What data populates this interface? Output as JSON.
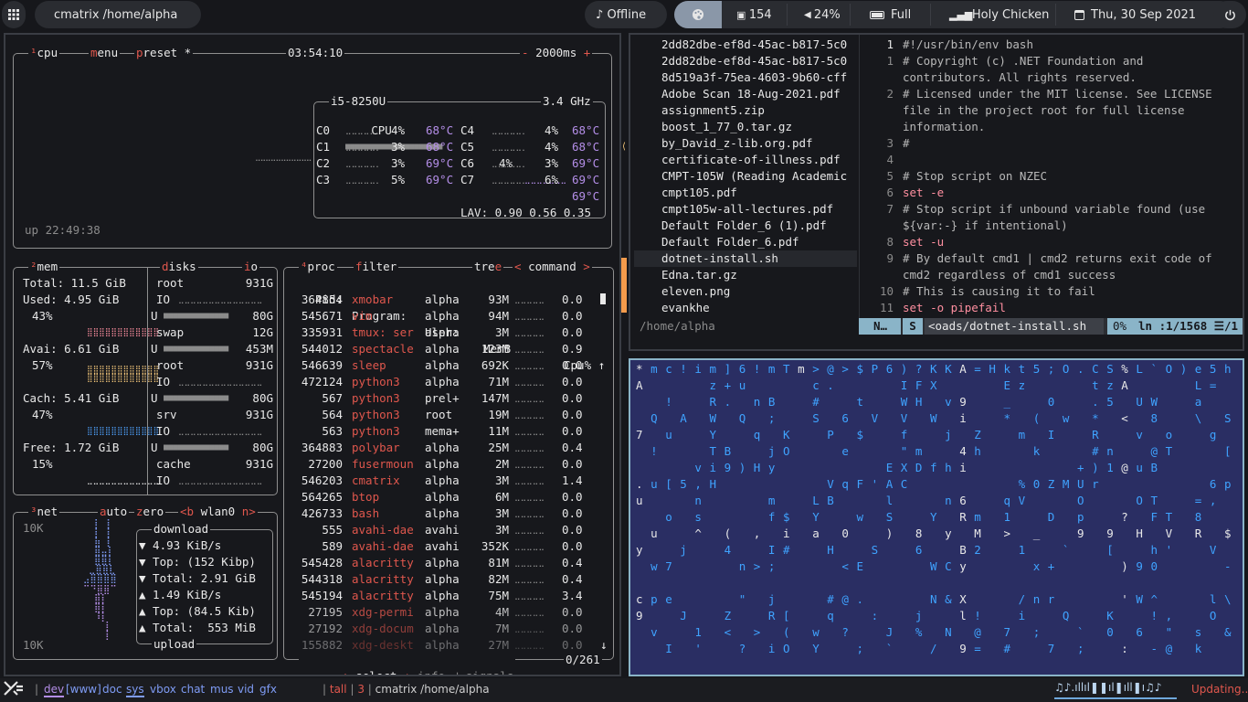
{
  "topbar": {
    "title": "cmatrix /home/alpha",
    "offline": "Offline",
    "count": "154",
    "volume": "24%",
    "battery": "Full",
    "wifi": "Holy Chicken",
    "date": "Thu, 30 Sep 2021"
  },
  "btop": {
    "cpu": {
      "tabs": {
        "cpu": "cpu",
        "menu": "menu",
        "preset": "preset *"
      },
      "clock": "03:54:10",
      "interval": "2000ms",
      "model": "i5-8250U",
      "freq": "3.4 GHz",
      "total_label": "CPU",
      "total_pct": "4%",
      "total_temp": "69°C",
      "cores": [
        {
          "n": "C0",
          "p": "4%",
          "t": "68°C",
          "n2": "C4",
          "p2": "4%",
          "t2": "68°C"
        },
        {
          "n": "C1",
          "p": "3%",
          "t": "68°C",
          "n2": "C5",
          "p2": "4%",
          "t2": "68°C"
        },
        {
          "n": "C2",
          "p": "3%",
          "t": "69°C",
          "n2": "C6",
          "p2": "3%",
          "t2": "69°C"
        },
        {
          "n": "C3",
          "p": "5%",
          "t": "69°C",
          "n2": "C7",
          "p2": "6%",
          "t2": "69°C"
        }
      ],
      "lav": "LAV: 0.90 0.56 0.35",
      "uptime": "up 22:49:38"
    },
    "mem": {
      "title": "mem",
      "total": "Total: 11.5 GiB",
      "used": "Used: 4.95 GiB",
      "used_pct": "43%",
      "avail": "Avai: 6.61 GiB",
      "avail_pct": "57%",
      "cache": "Cach: 5.41 GiB",
      "cache_pct": "47%",
      "free": "Free: 1.72 GiB",
      "free_pct": "15%"
    },
    "disks": {
      "title": "disks",
      "io": "io",
      "items": [
        {
          "name": "root",
          "size": "931G",
          "io": "IO",
          "u": "U",
          "val": "80G"
        },
        {
          "name": "swap",
          "size": "12G",
          "io": "",
          "u": "U",
          "val": "453M"
        },
        {
          "name": "root",
          "size": "931G",
          "io": "IO",
          "u": "U",
          "val": "80G"
        },
        {
          "name": "srv",
          "size": "931G",
          "io": "IO",
          "u": "U",
          "val": "80G"
        },
        {
          "name": "cache",
          "size": "931G",
          "io": "IO",
          "u": "",
          "val": ""
        }
      ]
    },
    "net": {
      "title": "net",
      "auto": "auto",
      "zero": "zero",
      "iface": "<b wlan0 n>",
      "scale_top": "10K",
      "scale_bottom": "10K",
      "download": "download",
      "dl_rate": "▼ 4.93 KiB/s",
      "dl_top": "▼ Top: (152 Kibp)",
      "dl_total": "▼ Total: 2.91 GiB",
      "ul_rate": "▲ 1.49 KiB/s",
      "ul_top": "▲ Top: (84.5 Kib)",
      "ul_total": "▲ Total:  553 MiB",
      "upload": "upload"
    },
    "proc": {
      "title": "proc",
      "filter": "filter",
      "tree": "tree",
      "command": "< command >",
      "headers": {
        "pid": "Pid:",
        "prog": "Program:",
        "user": "User:",
        "mem": "MemB",
        "cpu": "Cpu% ↑"
      },
      "rows": [
        {
          "pid": "364854",
          "prog": "xmobar",
          "user": "alpha",
          "mem": "93M",
          "cpu": "0.0"
        },
        {
          "pid": "545671",
          "prog": "vim",
          "user": "alpha",
          "mem": "94M",
          "cpu": "0.0"
        },
        {
          "pid": "335931",
          "prog": "tmux: ser",
          "user": "alpha",
          "mem": "3M",
          "cpu": "0.0"
        },
        {
          "pid": "544012",
          "prog": "spectacle",
          "user": "alpha",
          "mem": "123M",
          "cpu": "0.9"
        },
        {
          "pid": "546639",
          "prog": "sleep",
          "user": "alpha",
          "mem": "692K",
          "cpu": "0.0"
        },
        {
          "pid": "472124",
          "prog": "python3",
          "user": "alpha",
          "mem": "71M",
          "cpu": "0.0"
        },
        {
          "pid": "567",
          "prog": "python3",
          "user": "prel+",
          "mem": "147M",
          "cpu": "0.0"
        },
        {
          "pid": "564",
          "prog": "python3",
          "user": "root",
          "mem": "19M",
          "cpu": "0.0"
        },
        {
          "pid": "563",
          "prog": "python3",
          "user": "mema+",
          "mem": "11M",
          "cpu": "0.0"
        },
        {
          "pid": "364883",
          "prog": "polybar",
          "user": "alpha",
          "mem": "25M",
          "cpu": "0.4"
        },
        {
          "pid": "27200",
          "prog": "fusermoun",
          "user": "alpha",
          "mem": "2M",
          "cpu": "0.0"
        },
        {
          "pid": "546203",
          "prog": "cmatrix",
          "user": "alpha",
          "mem": "3M",
          "cpu": "1.4"
        },
        {
          "pid": "564265",
          "prog": "btop",
          "user": "alpha",
          "mem": "6M",
          "cpu": "0.0"
        },
        {
          "pid": "426733",
          "prog": "bash",
          "user": "alpha",
          "mem": "3M",
          "cpu": "0.0"
        },
        {
          "pid": "555",
          "prog": "avahi-dae",
          "user": "avahi",
          "mem": "3M",
          "cpu": "0.0"
        },
        {
          "pid": "589",
          "prog": "avahi-dae",
          "user": "avahi",
          "mem": "352K",
          "cpu": "0.0"
        },
        {
          "pid": "545428",
          "prog": "alacritty",
          "user": "alpha",
          "mem": "81M",
          "cpu": "0.4"
        },
        {
          "pid": "544318",
          "prog": "alacritty",
          "user": "alpha",
          "mem": "82M",
          "cpu": "0.4"
        },
        {
          "pid": "545194",
          "prog": "alacritty",
          "user": "alpha",
          "mem": "75M",
          "cpu": "3.4"
        },
        {
          "pid": "27195",
          "prog": "xdg-permi",
          "user": "alpha",
          "mem": "4M",
          "cpu": "0.0"
        },
        {
          "pid": "27192",
          "prog": "xdg-docum",
          "user": "alpha",
          "mem": "7M",
          "cpu": "0.0"
        },
        {
          "pid": "155882",
          "prog": "xdg-deskt",
          "user": "alpha",
          "mem": "27M",
          "cpu": "0.0"
        }
      ],
      "footer": {
        "select": "select",
        "info": "info",
        "signals": "signals",
        "count": "0/261"
      }
    }
  },
  "vim": {
    "files": [
      "2dd82dbe-ef8d-45ac-b817-5c0",
      "2dd82dbe-ef8d-45ac-b817-5c0",
      "8d519a3f-75ea-4603-9b60-cff",
      "Adobe Scan 18-Aug-2021.pdf",
      "assignment5.zip",
      "boost_1_77_0.tar.gz",
      "by_David_z-lib.org.pdf",
      "certificate-of-illness.pdf",
      "CMPT-105W (Reading Academic",
      "cmpt105.pdf",
      "cmpt105w-all-lectures.pdf",
      "Default Folder_6 (1).pdf",
      "Default Folder_6.pdf",
      "dotnet-install.sh",
      "Edna.tar.gz",
      "eleven.png",
      "evankhe"
    ],
    "cwd": "/home/alpha",
    "code": [
      {
        "n": "1",
        "t": "#!/usr/bin/env bash"
      },
      {
        "n": "1",
        "t": "# Copyright (c) .NET Foundation and"
      },
      {
        "n": "",
        "t": "contributors. All rights reserved."
      },
      {
        "n": "2",
        "t": "# Licensed under the MIT license. See LICENSE"
      },
      {
        "n": "",
        "t": "file in the project root for full license"
      },
      {
        "n": "",
        "t": "information."
      },
      {
        "n": "3",
        "t": "#"
      },
      {
        "n": "4",
        "t": ""
      },
      {
        "n": "5",
        "t": "# Stop script on NZEC"
      },
      {
        "n": "6",
        "t": "set -e"
      },
      {
        "n": "7",
        "t": "# Stop script if unbound variable found (use"
      },
      {
        "n": "",
        "t": "${var:-} if intentional)"
      },
      {
        "n": "8",
        "t": "set -u"
      },
      {
        "n": "9",
        "t": "# By default cmd1 | cmd2 returns exit code of"
      },
      {
        "n": "",
        "t": "cmd2 regardless of cmd1 success"
      },
      {
        "n": "10",
        "t": "# This is causing it to fail"
      },
      {
        "n": "11",
        "t": "set -o pipefail"
      }
    ],
    "status": {
      "mode": "N…",
      "s": "S",
      "file": "<oads/dotnet-install.sh",
      "pct": "0%",
      "pos": "ln :1/1568 ☰/1"
    }
  },
  "bottombar": {
    "workspaces": [
      "dev",
      "[www]",
      "doc",
      "sys",
      "vbox",
      "chat",
      "mus",
      "vid",
      "gfx"
    ],
    "layout": "tall",
    "count": "3",
    "title": "cmatrix /home/alpha",
    "music": "♫♪.ıllıl❚❚ıl❚ıll❚ı♫♪",
    "updating": "Updating..."
  }
}
